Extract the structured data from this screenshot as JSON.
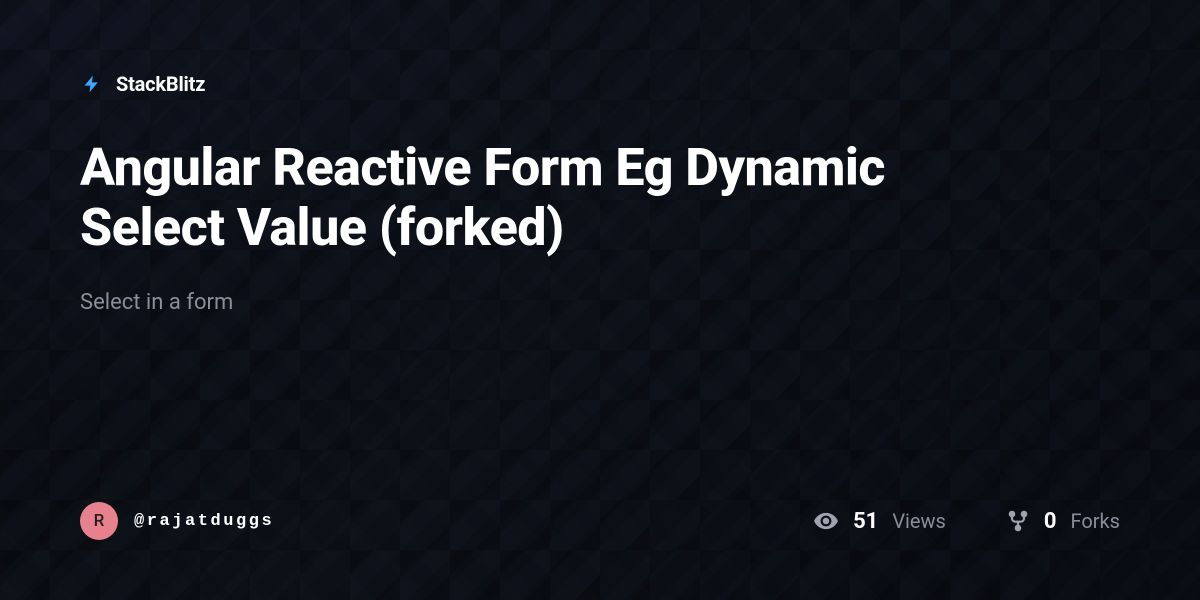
{
  "brand": {
    "name": "StackBlitz",
    "icon": "bolt-icon"
  },
  "project": {
    "title": "Angular Reactive Form Eg Dynamic Select Value (forked)",
    "description": "Select in a form"
  },
  "author": {
    "avatar_initial": "R",
    "username": "@rajatduggs"
  },
  "stats": {
    "views": {
      "count": "51",
      "label": "Views"
    },
    "forks": {
      "count": "0",
      "label": "Forks"
    }
  },
  "colors": {
    "accent": "#3ea6ff",
    "avatar_bg": "#e8818e"
  }
}
